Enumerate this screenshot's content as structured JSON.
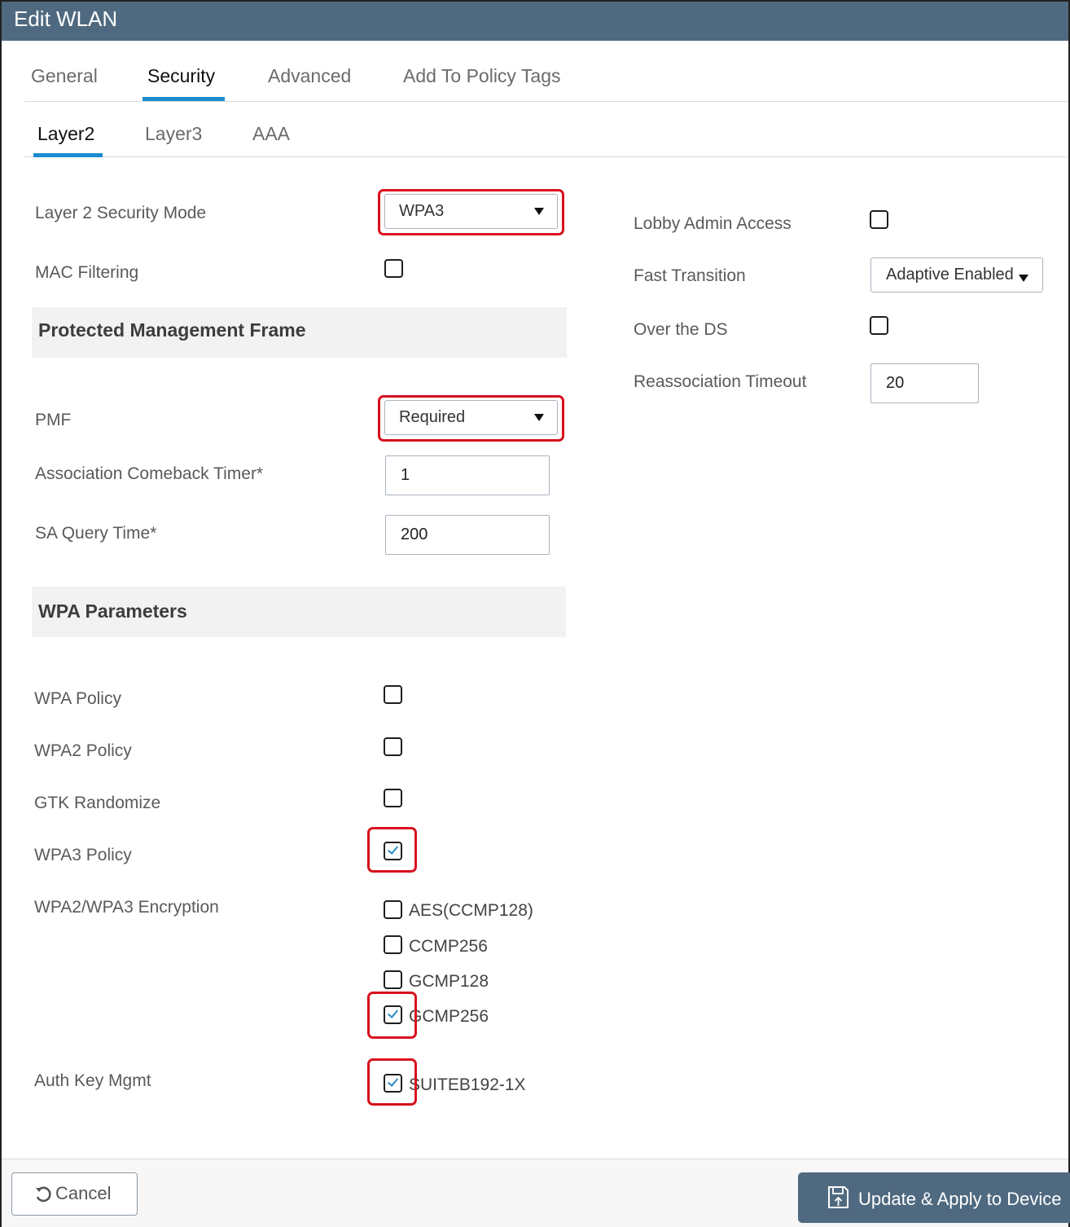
{
  "window": {
    "title": "Edit WLAN"
  },
  "tabs": [
    {
      "label": "General"
    },
    {
      "label": "Security"
    },
    {
      "label": "Advanced"
    },
    {
      "label": "Add To Policy Tags"
    }
  ],
  "subtabs": [
    {
      "label": "Layer2"
    },
    {
      "label": "Layer3"
    },
    {
      "label": "AAA"
    }
  ],
  "left": {
    "security_mode": {
      "label": "Layer 2 Security Mode",
      "value": "WPA3"
    },
    "mac_filtering": {
      "label": "MAC Filtering",
      "checked": false
    },
    "pmf_section": {
      "title": "Protected Management Frame"
    },
    "pmf": {
      "label": "PMF",
      "value": "Required"
    },
    "comeback_timer": {
      "label": "Association Comeback Timer*",
      "value": "1"
    },
    "sa_query": {
      "label": "SA Query Time*",
      "value": "200"
    },
    "wpa_section": {
      "title": "WPA Parameters"
    },
    "wpa_policy": {
      "label": "WPA Policy",
      "checked": false
    },
    "wpa2_policy": {
      "label": "WPA2 Policy",
      "checked": false
    },
    "gtk_randomize": {
      "label": "GTK Randomize",
      "checked": false
    },
    "wpa3_policy": {
      "label": "WPA3 Policy",
      "checked": true
    },
    "encryption": {
      "label": "WPA2/WPA3 Encryption",
      "options": [
        {
          "label": "AES(CCMP128)",
          "checked": false
        },
        {
          "label": "CCMP256",
          "checked": false
        },
        {
          "label": "GCMP128",
          "checked": false
        },
        {
          "label": "GCMP256",
          "checked": true
        }
      ]
    },
    "auth_key_mgmt": {
      "label": "Auth Key Mgmt",
      "options": [
        {
          "label": "SUITEB192-1X",
          "checked": true
        }
      ]
    }
  },
  "right": {
    "lobby_admin": {
      "label": "Lobby Admin Access",
      "checked": false
    },
    "fast_transition": {
      "label": "Fast Transition",
      "value": "Adaptive Enabled"
    },
    "over_ds": {
      "label": "Over the DS",
      "checked": false
    },
    "reassoc_timeout": {
      "label": "Reassociation Timeout",
      "value": "20"
    }
  },
  "footer": {
    "cancel_label": "Cancel",
    "update_label": "Update & Apply to Device"
  },
  "colors": {
    "titlebar": "#4f6a80",
    "tab_accent": "#1a8ccf",
    "highlight": "#d9101d",
    "check": "#2a8bc4"
  }
}
